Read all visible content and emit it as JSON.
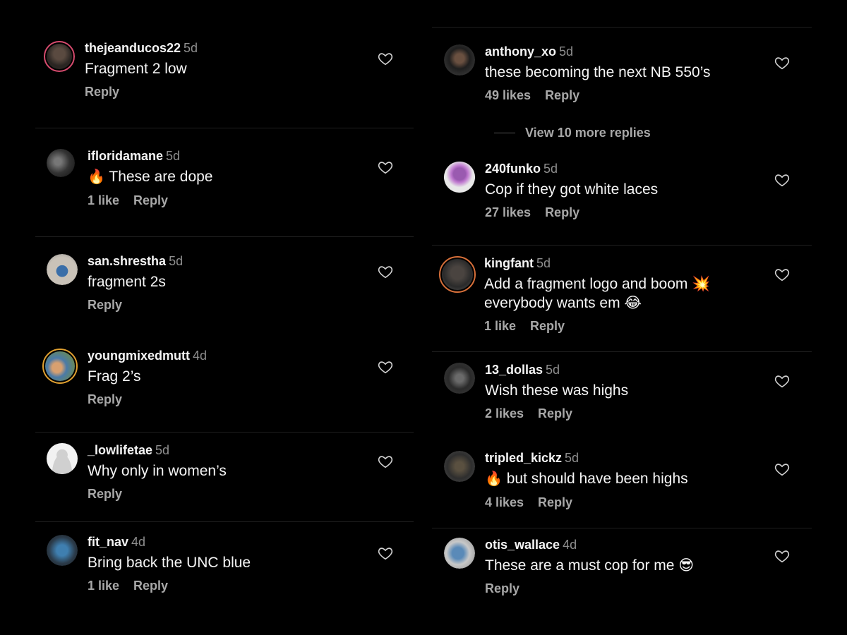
{
  "icons": {
    "like": "heart-outline-icon"
  },
  "left_comments": [
    {
      "username": "thejeanducos22",
      "time": "5d",
      "text": "Fragment 2 low",
      "likes": "",
      "reply": "Reply"
    },
    {
      "username": "ifloridamane",
      "time": "5d",
      "text": "These are dope",
      "emoji_before": "🔥",
      "likes": "1 like",
      "reply": "Reply"
    },
    {
      "username": "san.shrestha",
      "time": "5d",
      "text": "fragment 2s",
      "likes": "",
      "reply": "Reply"
    },
    {
      "username": "youngmixedmutt",
      "time": "4d",
      "text": "Frag 2’s",
      "likes": "",
      "reply": "Reply"
    },
    {
      "username": "_lowlifetae",
      "time": "5d",
      "text": "Why only in women’s",
      "likes": "",
      "reply": "Reply"
    },
    {
      "username": "fit_nav",
      "time": "4d",
      "text": "Bring back the UNC blue",
      "likes": "1 like",
      "reply": "Reply"
    }
  ],
  "right_comments": [
    {
      "username": "anthony_xo",
      "time": "5d",
      "text": "these becoming the next NB 550’s",
      "likes": "49 likes",
      "reply": "Reply"
    },
    {
      "username": "240funko",
      "time": "5d",
      "text": "Cop if they got white laces",
      "likes": "27 likes",
      "reply": "Reply"
    },
    {
      "username": "kingfant",
      "time": "5d",
      "text": "Add a fragment logo and boom 💥 everybody wants em 😂",
      "likes": "1 like",
      "reply": "Reply"
    },
    {
      "username": "13_dollas",
      "time": "5d",
      "text": "Wish these was highs",
      "likes": "2 likes",
      "reply": "Reply"
    },
    {
      "username": "tripled_kickz",
      "time": "5d",
      "text": "but should have been highs",
      "emoji_before": "🔥",
      "likes": "4 likes",
      "reply": "Reply"
    },
    {
      "username": "otis_wallace",
      "time": "4d",
      "text": "These are a must cop for me 😎",
      "likes": "",
      "reply": "Reply"
    }
  ],
  "view_more_replies": "View 10 more replies"
}
